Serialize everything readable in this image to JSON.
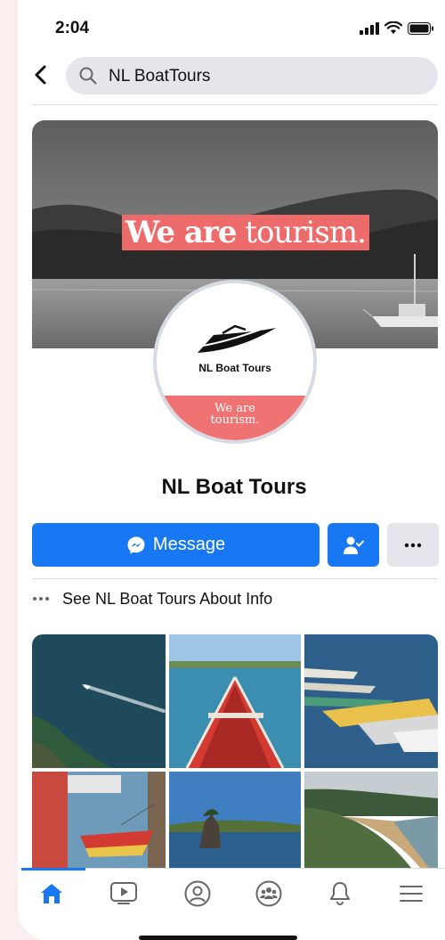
{
  "status_bar": {
    "time": "2:04",
    "icons": [
      "signal-icon",
      "wifi-icon",
      "battery-icon"
    ]
  },
  "search": {
    "query": "NL BoatTours",
    "icon": "search-icon",
    "back_icon": "chevron-left-icon"
  },
  "cover": {
    "text_bold": "We are",
    "text_light": " tourism."
  },
  "avatar": {
    "logo_icon": "boat-logo-icon",
    "name": "NL Boat Tours",
    "band_line1": "We are",
    "band_line2": "tourism."
  },
  "page": {
    "title": "NL Boat Tours"
  },
  "actions": {
    "message_label": "Message",
    "message_icon": "messenger-icon",
    "follow_icon": "person-check-icon",
    "more_icon": "more-horizontal-icon"
  },
  "about": {
    "label": "See NL Boat Tours About Info",
    "icon": "more-horizontal-icon"
  },
  "photos": [
    {
      "name": "speedboat-aerial"
    },
    {
      "name": "red-rowboat-bow"
    },
    {
      "name": "colorful-dories"
    },
    {
      "name": "harbor-dory"
    },
    {
      "name": "rock-stack"
    },
    {
      "name": "beach-coastline"
    }
  ],
  "tabbar": {
    "active": "home",
    "tabs": [
      "home-icon",
      "video-icon",
      "profile-icon",
      "groups-icon",
      "notifications-icon",
      "menu-icon"
    ]
  },
  "colors": {
    "accent": "#1877f2",
    "coral": "#ee6b6b",
    "secondary_button": "#e4e6eb"
  }
}
